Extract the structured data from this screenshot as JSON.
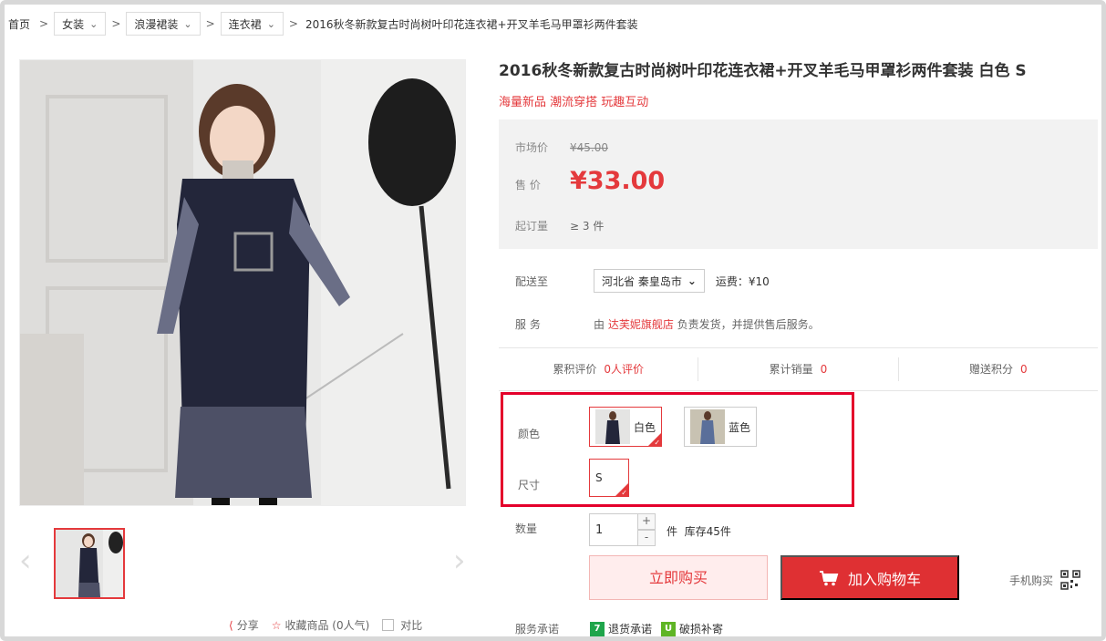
{
  "breadcrumb": {
    "home": "首页",
    "sep": ">",
    "levels": [
      "女装",
      "浪漫裙装",
      "连衣裙"
    ],
    "current": "2016秋冬新款复古时尚树叶印花连衣裙+开叉羊毛马甲罩衫两件套装"
  },
  "product": {
    "title": "2016秋冬新款复古时尚树叶印花连衣裙+开叉羊毛马甲罩衫两件套装 白色 S",
    "tagline": "海量新品 潮流穿搭 玩趣互动"
  },
  "price": {
    "market_label": "市场价",
    "market_value": "¥45.00",
    "sale_label": "售  价",
    "sale_value": "¥33.00",
    "moq_label": "起订量",
    "moq_value": "≥ 3 件"
  },
  "delivery": {
    "label": "配送至",
    "region": "河北省 秦皇岛市",
    "freight": "运费：¥10"
  },
  "service": {
    "label": "服  务",
    "prefix": "由 ",
    "store": "达芙妮旗舰店",
    "suffix": " 负责发货，并提供售后服务。"
  },
  "stats": [
    {
      "label": "累积评价",
      "value": "0人评价"
    },
    {
      "label": "累计销量",
      "value": "0"
    },
    {
      "label": "赠送积分",
      "value": "0"
    }
  ],
  "sku": {
    "color_label": "颜色",
    "colors": [
      "白色",
      "蓝色"
    ],
    "size_label": "尺寸",
    "sizes": [
      "S"
    ]
  },
  "quantity": {
    "label": "数量",
    "value": "1",
    "plus": "+",
    "minus": "-",
    "unit": "件",
    "stock": "库存45件"
  },
  "actions": {
    "buy_now": "立即购买",
    "add_cart": "加入购物车",
    "mobile_buy": "手机购买"
  },
  "share": {
    "share": "分享",
    "favorite": "收藏商品 (0人气)",
    "compare": "对比"
  },
  "promise": {
    "label": "服务承诺",
    "items": [
      {
        "icon": "7",
        "text": "退货承诺"
      },
      {
        "icon": "U",
        "text": "破损补寄"
      }
    ]
  },
  "colors": {
    "accent": "#e4393c",
    "cart_button": "#df3033",
    "price_bg": "#f2f2f2"
  }
}
